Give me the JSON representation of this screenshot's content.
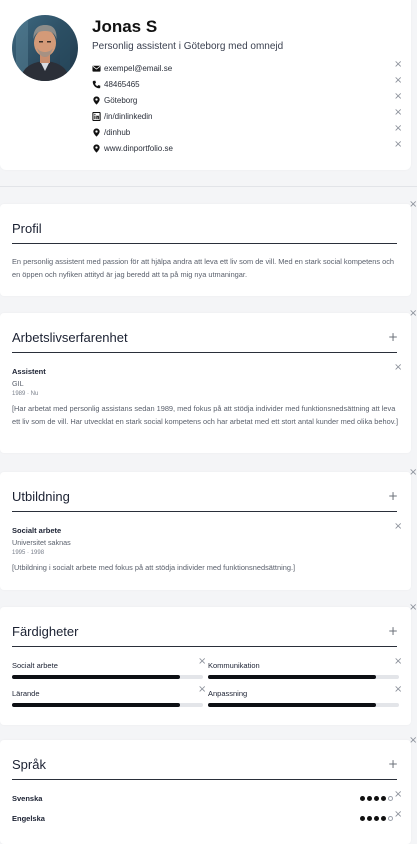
{
  "header": {
    "name": "Jonas S",
    "subtitle": "Personlig assistent i Göteborg med omnejd",
    "contacts": [
      {
        "icon": "envelope-icon",
        "text": "exempel@email.se"
      },
      {
        "icon": "phone-icon",
        "text": "48465465"
      },
      {
        "icon": "map-pin-icon",
        "text": "Göteborg"
      },
      {
        "icon": "linkedin-icon",
        "text": "/in/dinlinkedin"
      },
      {
        "icon": "map-pin-icon",
        "text": "/dinhub"
      },
      {
        "icon": "map-pin-icon",
        "text": "www.dinportfolio.se"
      }
    ]
  },
  "glyphs": {
    "close": "×",
    "add": "+"
  },
  "profile": {
    "title": "Profil",
    "text": "En personlig assistent med passion för att hjälpa andra att leva ett liv som de vill. Med en stark social kompetens och en öppen och nyfiken attityd är jag beredd att ta på mig nya utmaningar."
  },
  "experience": {
    "title": "Arbetslivserfarenhet",
    "items": [
      {
        "title": "Assistent",
        "company": "GIL",
        "dates": "1989 · Nu",
        "description": "[Har arbetat med personlig assistans sedan 1989, med fokus på att stödja individer med funktionsnedsättning att leva ett liv som de vill. Har utvecklat en stark social kompetens och har arbetat med ett stort antal kunder med olika behov.]"
      }
    ]
  },
  "education": {
    "title": "Utbildning",
    "items": [
      {
        "title": "Socialt arbete",
        "school": "Universitet saknas",
        "dates": "1995 · 1998",
        "description": "[Utbildning i socialt arbete med fokus på att stödja individer med funktionsnedsättning.]"
      }
    ]
  },
  "skills": {
    "title": "Färdigheter",
    "items": [
      {
        "label": "Socialt arbete",
        "level": 0.88
      },
      {
        "label": "Kommunikation",
        "level": 0.88
      },
      {
        "label": "Lärande",
        "level": 0.88
      },
      {
        "label": "Anpassning",
        "level": 0.88
      }
    ]
  },
  "languages": {
    "title": "Språk",
    "items": [
      {
        "label": "Svenska",
        "rating": 4,
        "max": 5
      },
      {
        "label": "Engelska",
        "rating": 4,
        "max": 5
      }
    ]
  },
  "colors": {
    "accent": "#0d0f14",
    "text": "#1b2132",
    "muted": "#5a606c",
    "background": "#f4f5f7",
    "card": "#ffffff"
  }
}
